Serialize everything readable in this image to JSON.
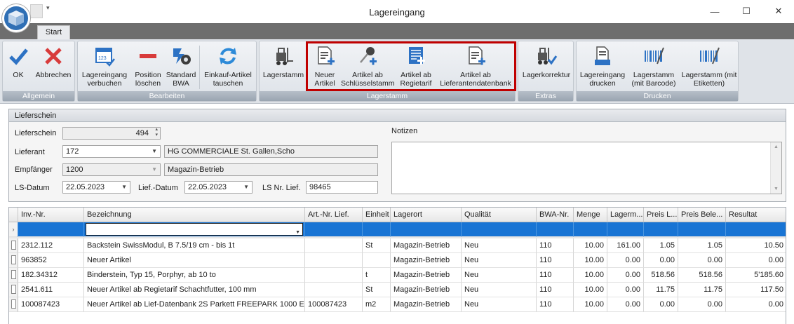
{
  "window": {
    "title": "Lagereingang",
    "controls": {
      "minimize": "—",
      "maximize": "☐",
      "close": "✕"
    },
    "qat_arrow": "▾"
  },
  "tabs": [
    {
      "label": "Start",
      "active": true
    }
  ],
  "ribbon": {
    "groups": [
      {
        "label": "Allgemein",
        "buttons": [
          {
            "label": [
              "OK"
            ],
            "icon": "check-icon"
          },
          {
            "label": [
              "Abbrechen"
            ],
            "icon": "cross-icon"
          }
        ]
      },
      {
        "label": "Bearbeiten",
        "buttons": [
          {
            "label": [
              "Lagereingang",
              "verbuchen"
            ],
            "icon": "book-entry-icon"
          },
          {
            "label": [
              "Position",
              "löschen"
            ],
            "icon": "minus-icon"
          },
          {
            "label": [
              "Standard",
              "BWA"
            ],
            "icon": "gear-icon"
          },
          {
            "label": [
              "Einkauf-Artikel",
              "tauschen"
            ],
            "icon": "refresh-icon"
          }
        ]
      },
      {
        "label": "Lagerstamm",
        "buttons": [
          {
            "label": [
              "Lagerstamm"
            ],
            "icon": "forklift-icon"
          },
          {
            "label": [
              "Neuer",
              "Artikel"
            ],
            "icon": "new-document-icon"
          },
          {
            "label": [
              "Artikel ab",
              "Schlüsselstamm"
            ],
            "icon": "key-add-icon"
          },
          {
            "label": [
              "Artikel ab",
              "Regietarif"
            ],
            "icon": "list-add-icon"
          },
          {
            "label": [
              "Artikel ab",
              "Lieferantendatenbank"
            ],
            "icon": "document-add-icon"
          }
        ]
      },
      {
        "label": "Extras",
        "buttons": [
          {
            "label": [
              "Lagerkorrektur"
            ],
            "icon": "forklift-check-icon"
          }
        ]
      },
      {
        "label": "Drucken",
        "buttons": [
          {
            "label": [
              "Lagereingang",
              "drucken"
            ],
            "icon": "print-document-icon"
          },
          {
            "label": [
              "Lagerstamm",
              "(mit Barcode)"
            ],
            "icon": "barcode-icon"
          },
          {
            "label": [
              "Lagerstamm (mit",
              "Etiketten)"
            ],
            "icon": "barcode-label-icon"
          }
        ]
      }
    ]
  },
  "lieferschein": {
    "section_title": "Lieferschein",
    "labels": {
      "lieferschein": "Lieferschein",
      "lieferant": "Lieferant",
      "empfaenger": "Empfänger",
      "ls_datum": "LS-Datum",
      "lief_datum": "Lief.-Datum",
      "ls_nr_lief": "LS Nr. Lief.",
      "notizen": "Notizen"
    },
    "values": {
      "lieferschein": "494",
      "lieferant_code": "172",
      "lieferant_name": "HG COMMERCIALE St. Gallen,Scho",
      "empfaenger_code": "1200",
      "empfaenger_name": "Magazin-Betrieb",
      "ls_datum": "22.05.2023",
      "lief_datum": "22.05.2023",
      "ls_nr_lief": "98465",
      "notizen": ""
    }
  },
  "grid": {
    "columns": [
      "Inv.-Nr.",
      "Bezeichnung",
      "Art.-Nr. Lief.",
      "Einheit",
      "Lagerort",
      "Qualität",
      "BWA-Nr.",
      "Menge",
      "Lagerm...",
      "Preis L...",
      "Preis Bele...",
      "Resultat"
    ],
    "rows": [
      [
        "2312.112",
        "Backstein SwissModul, B 7.5/19 cm - bis 1t",
        "",
        "St",
        "Magazin-Betrieb",
        "Neu",
        "110",
        "10.00",
        "161.00",
        "1.05",
        "1.05",
        "10.50"
      ],
      [
        "963852",
        "Neuer Artikel",
        "",
        "",
        "Magazin-Betrieb",
        "Neu",
        "110",
        "10.00",
        "0.00",
        "0.00",
        "0.00",
        "0.00"
      ],
      [
        "182.34312",
        "Binderstein, Typ 15, Porphyr, ab 10 to",
        "",
        "t",
        "Magazin-Betrieb",
        "Neu",
        "110",
        "10.00",
        "0.00",
        "518.56",
        "518.56",
        "5'185.60"
      ],
      [
        "2541.611",
        "Neuer Artikel ab Regietarif Schachtfutter, 100 mm",
        "",
        "St",
        "Magazin-Betrieb",
        "Neu",
        "110",
        "10.00",
        "0.00",
        "11.75",
        "11.75",
        "117.50"
      ],
      [
        "100087423",
        "Neuer Artikel ab Lief-Datenbank 2S Parkett FREEPARK 1000 E...",
        "100087423",
        "m2",
        "Magazin-Betrieb",
        "Neu",
        "110",
        "10.00",
        "0.00",
        "0.00",
        "0.00",
        "0.00"
      ]
    ]
  }
}
